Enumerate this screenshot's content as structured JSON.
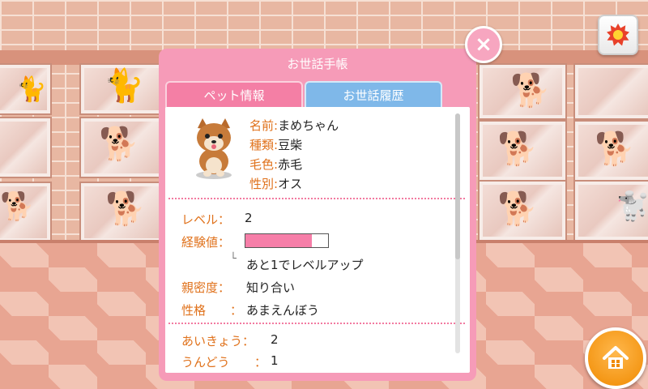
{
  "dialog": {
    "title": "お世話手帳",
    "tabs": [
      "ペット情報",
      "お世話履歴"
    ],
    "close_symbol": "×"
  },
  "pet": {
    "name_label": "名前:",
    "name": "まめちゃん",
    "breed_label": "種類:",
    "breed": "豆柴",
    "coat_label": "毛色:",
    "coat": "赤毛",
    "sex_label": "性別:",
    "sex": "オス"
  },
  "stats": {
    "level_label": "レベル：",
    "level": "2",
    "exp_label": "経験値：",
    "exp_fraction": 0.8,
    "exp_note_mark": "└",
    "exp_note": "あと1でレベルアップ",
    "intimacy_label": "親密度：",
    "intimacy": "知り合い",
    "personality_label": "性格",
    "personality_colon": "：",
    "personality": "あまえんぼう",
    "charm_label": "あいきょう：",
    "charm": "2",
    "exercise_label": "うんどう",
    "exercise_colon": "：",
    "exercise": "1"
  },
  "colors": {
    "accent_pink": "#f69bb8",
    "label_orange": "#e0721c",
    "tab_blue": "#7fb8e9"
  },
  "icons": {
    "close": "close-icon",
    "settings": "burst-icon",
    "home": "home-icon"
  }
}
